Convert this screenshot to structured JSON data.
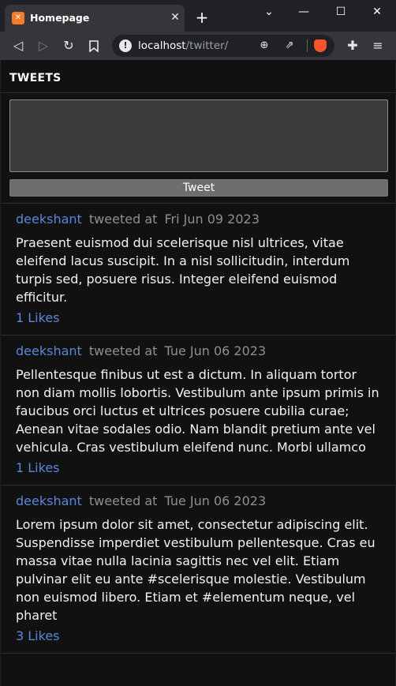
{
  "browser": {
    "tab_title": "Homepage",
    "favicon": "xampp-icon",
    "new_tab": "+",
    "url_host": "localhost",
    "url_path": "/twitter/"
  },
  "page": {
    "title": "TWEETS",
    "compose": {
      "placeholder": "",
      "button_label": "Tweet"
    },
    "tweets": [
      {
        "author": "deekshant",
        "label": "tweeted at",
        "date": "Fri Jun 09 2023",
        "body": "Praesent euismod dui scelerisque nisl ultrices, vitae eleifend lacus suscipit. In a nisl sollicitudin, interdum turpis sed, posuere risus. Integer eleifend euismod efficitur.",
        "likes": "1 Likes"
      },
      {
        "author": "deekshant",
        "label": "tweeted at",
        "date": "Tue Jun 06 2023",
        "body": "Pellentesque finibus ut est a dictum. In aliquam tortor non diam mollis lobortis. Vestibulum ante ipsum primis in faucibus orci luctus et ultrices posuere cubilia curae; Aenean vitae sodales odio. Nam blandit pretium ante vel vehicula. Cras vestibulum eleifend nunc. Morbi ullamco",
        "likes": "1 Likes"
      },
      {
        "author": "deekshant",
        "label": "tweeted at",
        "date": "Tue Jun 06 2023",
        "body": "Lorem ipsum dolor sit amet, consectetur adipiscing elit. Suspendisse imperdiet vestibulum pellentesque. Cras eu massa vitae nulla lacinia sagittis nec vel elit. Etiam pulvinar elit eu ante #scelerisque molestie. Vestibulum non euismod libero. Etiam et #elementum neque, vel pharet",
        "likes": "3 Likes"
      }
    ]
  },
  "colors": {
    "background": "#111111",
    "link": "#5b86d8",
    "muted": "#8f8f8f",
    "button": "#6e6e6e"
  }
}
